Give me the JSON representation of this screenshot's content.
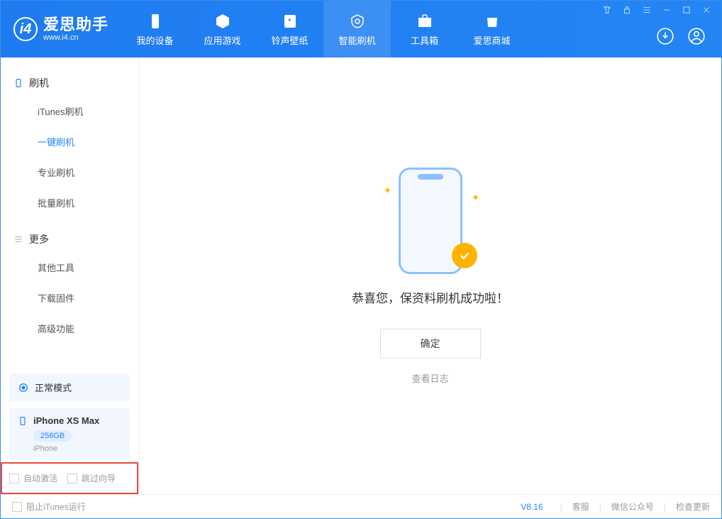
{
  "app": {
    "name": "爱思助手",
    "url": "www.i4.cn"
  },
  "nav": {
    "items": [
      {
        "id": "device",
        "label": "我的设备"
      },
      {
        "id": "apps",
        "label": "应用游戏"
      },
      {
        "id": "ringtone",
        "label": "铃声壁纸"
      },
      {
        "id": "flash",
        "label": "智能刷机"
      },
      {
        "id": "toolbox",
        "label": "工具箱"
      },
      {
        "id": "store",
        "label": "爱思商城"
      }
    ]
  },
  "sidebar": {
    "flash_title": "刷机",
    "flash_items": [
      {
        "label": "iTunes刷机"
      },
      {
        "label": "一键刷机"
      },
      {
        "label": "专业刷机"
      },
      {
        "label": "批量刷机"
      }
    ],
    "more_title": "更多",
    "more_items": [
      {
        "label": "其他工具"
      },
      {
        "label": "下载固件"
      },
      {
        "label": "高级功能"
      }
    ]
  },
  "mode": {
    "label": "正常模式"
  },
  "device": {
    "name": "iPhone XS Max",
    "capacity": "256GB",
    "type": "iPhone"
  },
  "options": {
    "auto_activate": "自动激活",
    "skip_setup": "跳过向导"
  },
  "main": {
    "message": "恭喜您，保资料刷机成功啦！",
    "ok": "确定",
    "view_log": "查看日志"
  },
  "status": {
    "block_itunes": "阻止iTunes运行",
    "version": "V8.16",
    "support": "客服",
    "wechat": "微信公众号",
    "check_update": "检查更新"
  }
}
